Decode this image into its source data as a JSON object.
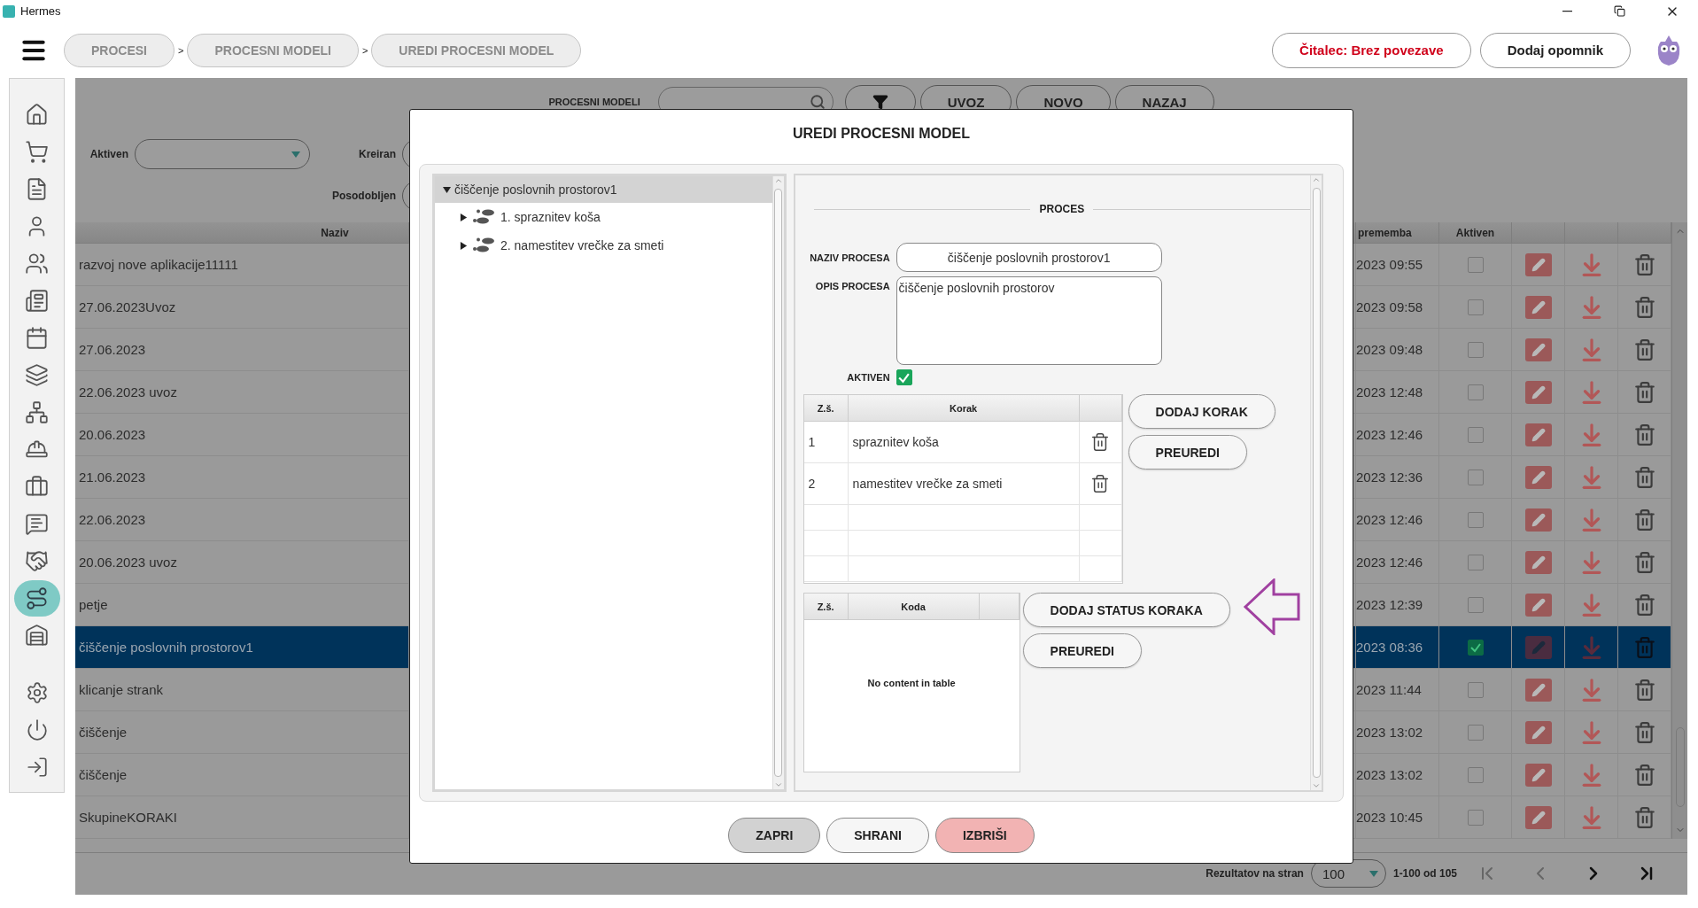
{
  "window": {
    "title": "Hermes"
  },
  "breadcrumbs": [
    {
      "label": "PROCESI",
      "separator": ">"
    },
    {
      "label": "PROCESNI MODELI",
      "separator": ">"
    },
    {
      "label": "UREDI PROCESNI MODEL"
    }
  ],
  "header_buttons": [
    {
      "label": "Čitalec: Brez povezave",
      "kind": "alert"
    },
    {
      "label": "Dodaj opomnik",
      "kind": "plain"
    }
  ],
  "sidebar": {
    "items": [
      {
        "selected": false
      },
      {
        "selected": false
      },
      {
        "selected": false
      },
      {
        "selected": false
      },
      {
        "selected": false
      },
      {
        "selected": false
      },
      {
        "selected": false
      },
      {
        "selected": false
      },
      {
        "selected": false
      },
      {
        "selected": false
      },
      {
        "selected": false
      },
      {
        "selected": false
      },
      {
        "selected": false
      },
      {
        "selected": true
      },
      {
        "selected": false
      }
    ],
    "bottom_items": [
      {
        "selected": false
      },
      {
        "selected": false
      },
      {
        "selected": false
      }
    ]
  },
  "toolbar": {
    "label": "PROCESNI MODELI",
    "buttons": [
      "UVOZ",
      "NOVO",
      "NAZAJ"
    ]
  },
  "filters": [
    {
      "label": "Aktiven",
      "kind": "select"
    },
    {
      "label": "Kreiran",
      "kind": "date"
    },
    {
      "label": "Posodobljen",
      "kind": "date"
    }
  ],
  "table": {
    "columns": [
      "Naziv",
      "prememba",
      "Aktiven"
    ],
    "rows": [
      {
        "name": "razvoj nove aplikacije11111",
        "changed": "2023 09:55",
        "active": false,
        "selected": false
      },
      {
        "name": "27.06.2023Uvoz",
        "changed": "2023 09:58",
        "active": false,
        "selected": false
      },
      {
        "name": "27.06.2023",
        "changed": "2023 09:48",
        "active": false,
        "selected": false
      },
      {
        "name": "22.06.2023 uvoz",
        "changed": "2023 12:48",
        "active": false,
        "selected": false
      },
      {
        "name": "20.06.2023",
        "changed": "2023 12:46",
        "active": false,
        "selected": false
      },
      {
        "name": "21.06.2023",
        "changed": "2023 12:36",
        "active": false,
        "selected": false
      },
      {
        "name": "22.06.2023",
        "changed": "2023 12:46",
        "active": false,
        "selected": false
      },
      {
        "name": "20.06.2023 uvoz",
        "changed": "2023 12:46",
        "active": false,
        "selected": false
      },
      {
        "name": "petje",
        "changed": "2023 12:39",
        "active": false,
        "selected": false
      },
      {
        "name": "čiščenje poslovnih prostorov1",
        "changed": "2023 08:36",
        "active": true,
        "selected": true
      },
      {
        "name": "klicanje strank",
        "changed": "2023 11:44",
        "active": false,
        "selected": false
      },
      {
        "name": "čiščenje",
        "changed": "2023 13:02",
        "active": false,
        "selected": false
      },
      {
        "name": "čiščenje",
        "changed": "2023 13:02",
        "active": false,
        "selected": false
      },
      {
        "name": "SkupineKORAKI",
        "changed": "2023 10:45",
        "active": false,
        "selected": false
      }
    ]
  },
  "pagination": {
    "label": "Rezultatov na stran",
    "page_size": "100",
    "range": "1-100 od 105"
  },
  "dialog": {
    "title": "UREDI PROCESNI MODEL",
    "tree": {
      "label": "čiščenje poslovnih prostorov1",
      "expanded": true,
      "selected": true,
      "children": [
        {
          "label": "1. spraznitev koša",
          "expanded": false
        },
        {
          "label": "2. namestitev vrečke za smeti",
          "expanded": false
        }
      ]
    },
    "section_title": "PROCES",
    "name_field": {
      "label": "NAZIV PROCESA",
      "value": "čiščenje poslovnih prostorov1"
    },
    "description_field": {
      "label": "OPIS PROCESA",
      "value": "čiščenje poslovnih prostorov"
    },
    "active_field": {
      "label": "AKTIVEN",
      "checked": true
    },
    "steps": {
      "columns": [
        "Z.š.",
        "Korak"
      ],
      "rows": [
        {
          "number": "1",
          "name": "spraznitev koša"
        },
        {
          "number": "2",
          "name": "namestitev vrečke za smeti"
        }
      ],
      "buttons": [
        "DODAJ KORAK",
        "PREUREDI"
      ]
    },
    "statuses": {
      "columns": [
        "Z.š.",
        "Koda"
      ],
      "empty_text": "No content in table",
      "buttons": [
        "DODAJ STATUS KORAKA",
        "PREUREDI"
      ]
    },
    "footer_buttons": [
      {
        "label": "ZAPRI",
        "kind": "neutral"
      },
      {
        "label": "SHRANI",
        "kind": "primary"
      },
      {
        "label": "IZBRIŠI",
        "kind": "danger"
      }
    ]
  }
}
